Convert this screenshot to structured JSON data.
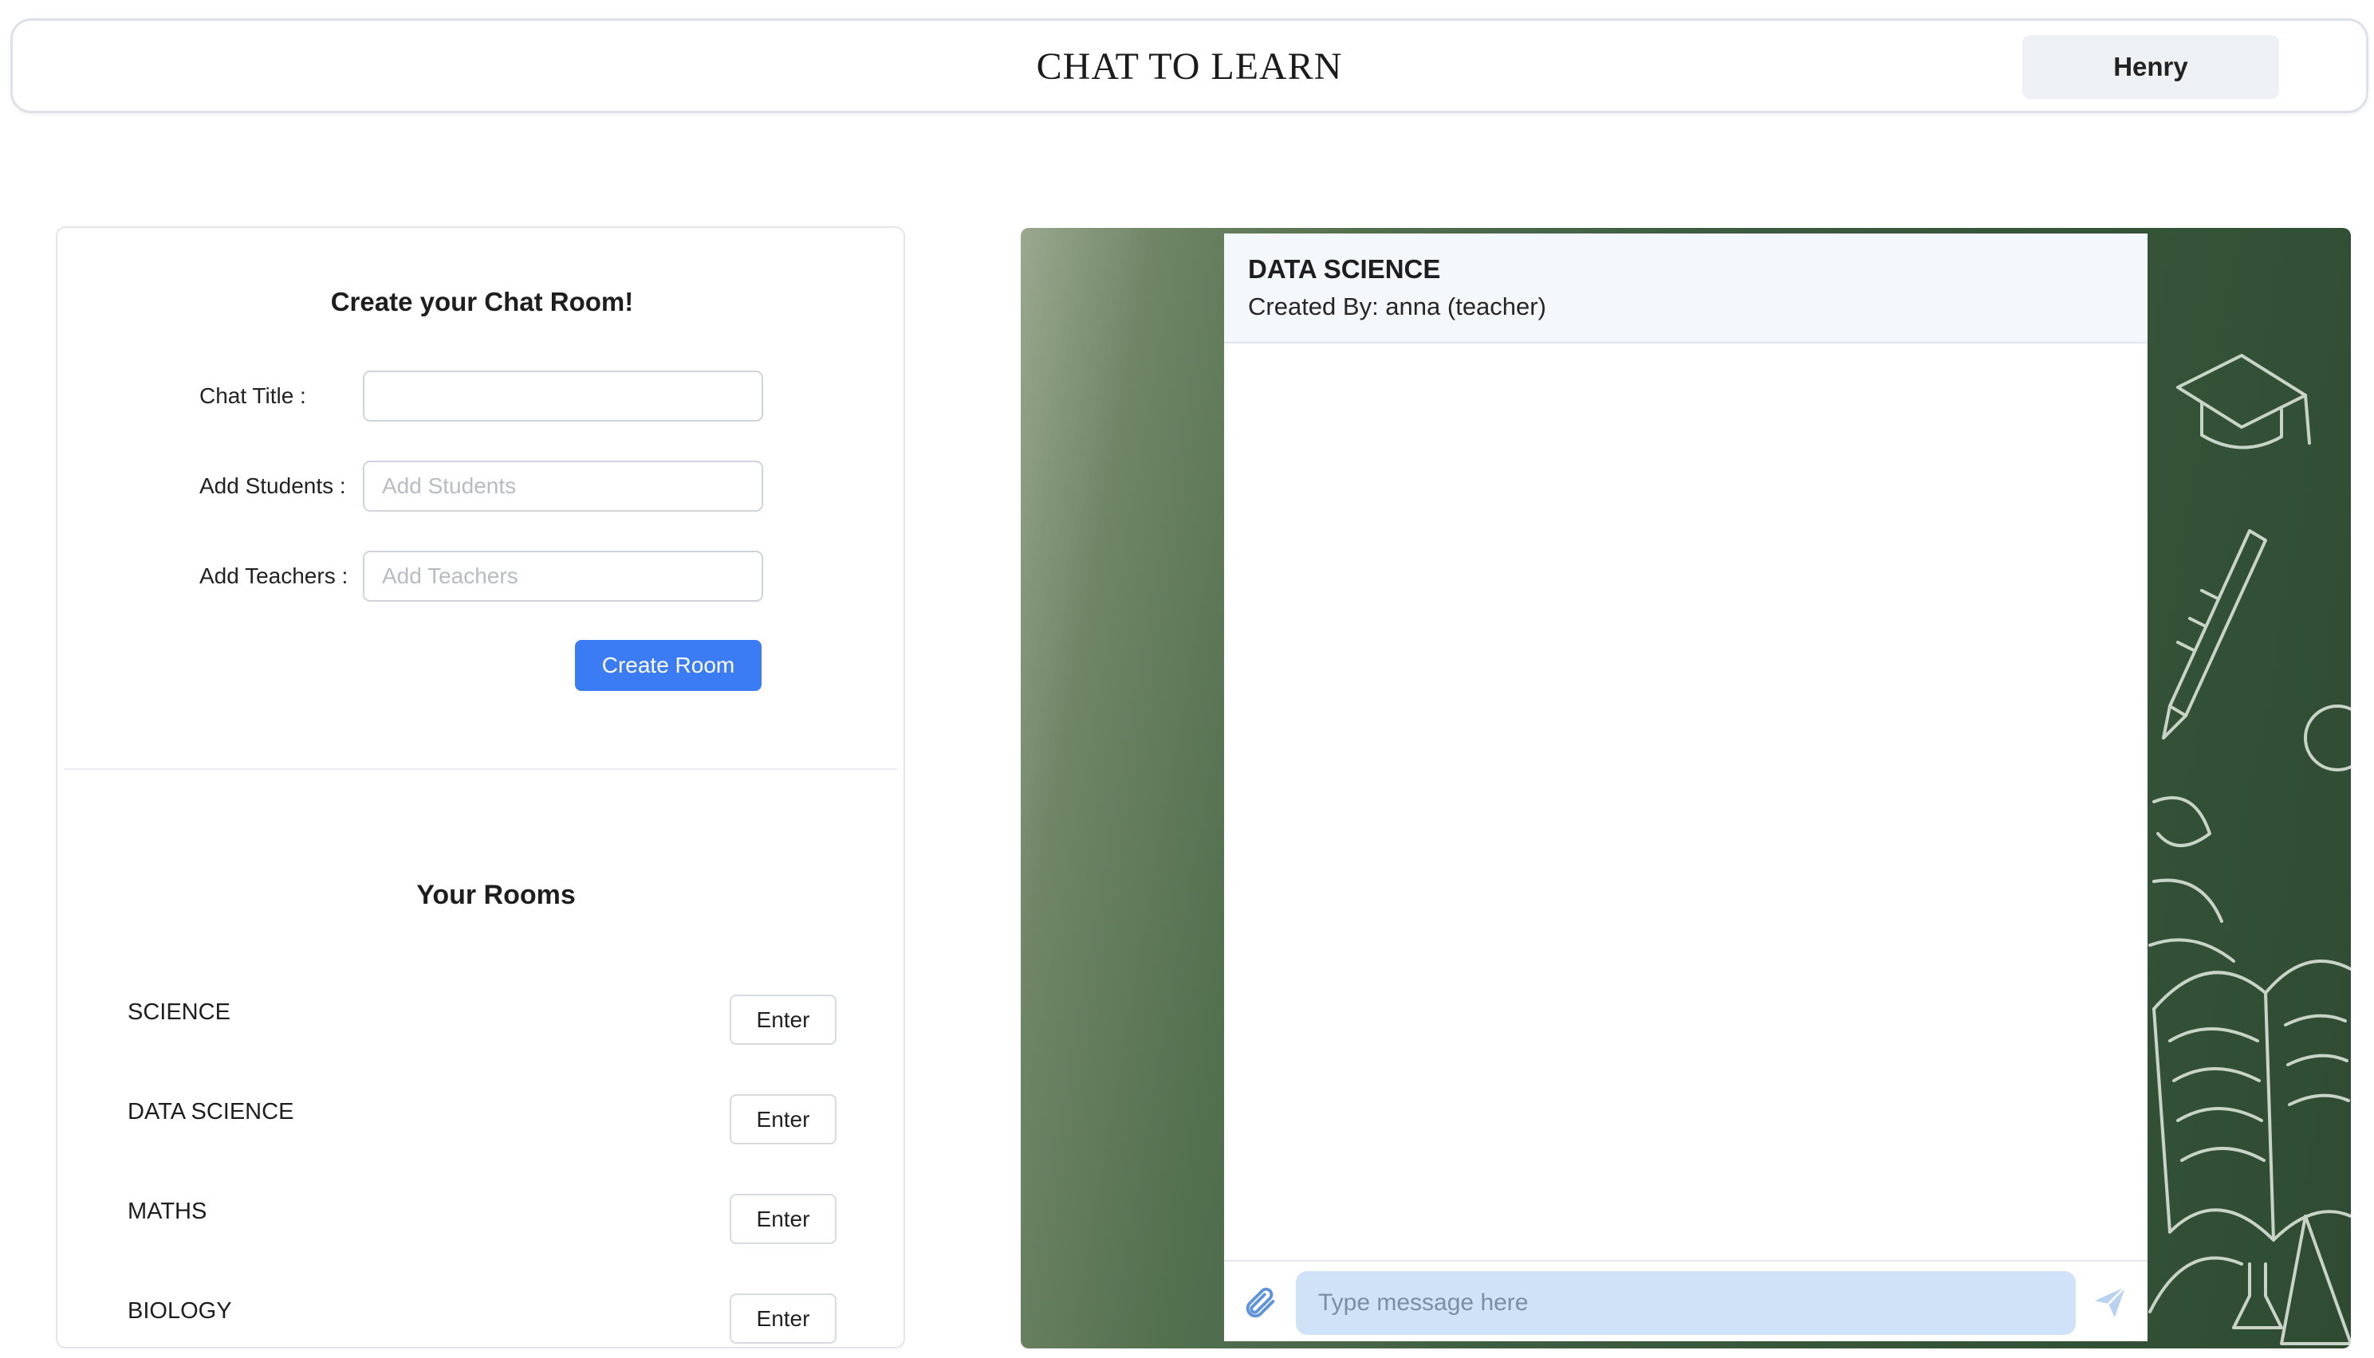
{
  "navbar": {
    "brand": "CHAT TO LEARN",
    "user_name": "Henry"
  },
  "create_room": {
    "title": "Create your Chat Room!",
    "chat_title_label": "Chat Title :",
    "chat_title_value": "",
    "students_label": "Add Students :",
    "students_placeholder": "Add Students",
    "teachers_label": "Add Teachers :",
    "teachers_placeholder": "Add Teachers",
    "create_button": "Create Room"
  },
  "rooms": {
    "title": "Your Rooms",
    "enter_label": "Enter",
    "items": [
      {
        "name": "SCIENCE"
      },
      {
        "name": "DATA SCIENCE"
      },
      {
        "name": "MATHS"
      },
      {
        "name": "BIOLOGY"
      }
    ]
  },
  "chat": {
    "room_title": "DATA SCIENCE",
    "created_by": "Created By: anna (teacher)",
    "message_placeholder": "Type message here",
    "attach_icon": "paperclip-icon",
    "send_icon": "send-icon",
    "accent": "#cfe2f8"
  },
  "colors": {
    "primary_button": "#3b7cf4",
    "chalkboard": "#355438"
  }
}
